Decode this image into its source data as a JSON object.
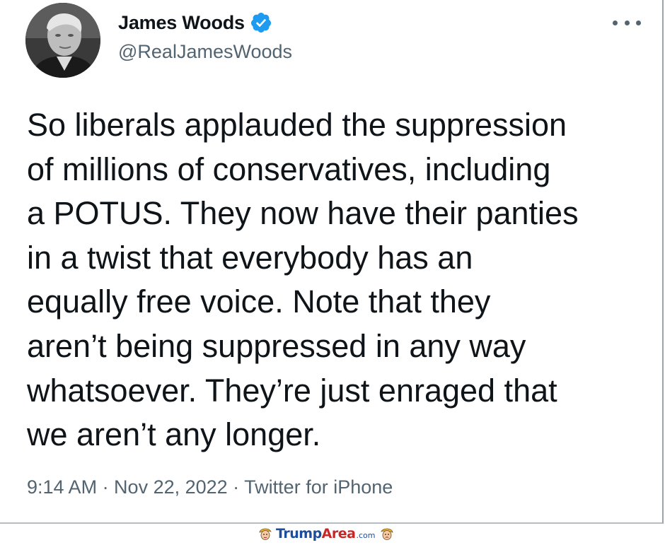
{
  "tweet": {
    "author": {
      "display_name": "James Woods",
      "handle": "@RealJamesWoods",
      "verified": true,
      "avatar_icon": "profile-photo"
    },
    "more_icon": "ellipsis-icon",
    "text": "So liberals applauded the suppression\nof millions of conservatives, including\na POTUS. They now have their panties\nin a twist that everybody has an\nequally free voice. Note that they\naren’t being suppressed in any way\nwhatsoever. They’re just enraged that\nwe aren’t any longer.",
    "meta": "9:14 AM · Nov 22, 2022 · Twitter for iPhone"
  },
  "watermark": {
    "brand_main": "Trump",
    "brand_accent": "Area",
    "brand_suffix": ".com",
    "icon": "trump-cartoon-icon"
  },
  "colors": {
    "verified_badge": "#1d9bf0",
    "secondary_text": "#536471",
    "primary_text": "#0f1419",
    "brand_blue": "#1d4e9e",
    "brand_red": "#c62828"
  }
}
